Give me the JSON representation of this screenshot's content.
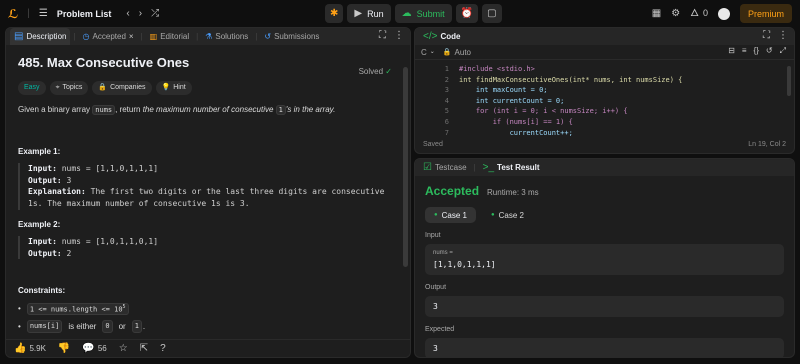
{
  "topbar": {
    "problem_list": "Problem List",
    "run": "Run",
    "submit": "Submit",
    "fire_count": "0",
    "premium": "Premium"
  },
  "left_tabs": [
    "Description",
    "Accepted",
    "Editorial",
    "Solutions",
    "Submissions"
  ],
  "problem": {
    "title": "485. Max Consecutive Ones",
    "solved": "Solved",
    "difficulty": "Easy",
    "chips": [
      "Topics",
      "Companies",
      "Hint"
    ],
    "statement_pre": "Given a binary array",
    "statement_code": "nums",
    "statement_mid": ", return",
    "statement_em": "the maximum number of consecutive",
    "statement_code2": "1",
    "statement_post": "'s in the array.",
    "example1_title": "Example 1:",
    "example1": {
      "input_label": "Input:",
      "input": "nums = [1,1,0,1,1,1]",
      "output_label": "Output:",
      "output": "3",
      "expl_label": "Explanation:",
      "explanation": "The first two digits or the last three digits are consecutive 1s. The maximum number of consecutive 1s is 3."
    },
    "example2_title": "Example 2:",
    "example2": {
      "input_label": "Input:",
      "input": "nums = [1,0,1,1,0,1]",
      "output_label": "Output:",
      "output": "2"
    },
    "constraints_title": "Constraints:",
    "constraint1": "1 <= nums.length <= 10",
    "constraint1_exp": "5",
    "constraint2_code": "nums[i]",
    "constraint2_mid": "is either",
    "constraint2_a": "0",
    "constraint2_or": "or",
    "constraint2_b": "1",
    "constraint2_end": "."
  },
  "footer": {
    "likes": "5.9K",
    "comments": "56"
  },
  "code": {
    "title": "Code",
    "language": "C",
    "auto": "Auto",
    "lines": [
      "#include <stdio.h>",
      "int findMaxConsecutiveOnes(int* nums, int numsSize) {",
      "    int maxCount = 0;",
      "    int currentCount = 0;",
      "    for (int i = 0; i < numsSize; i++) {",
      "        if (nums[i] == 1) {",
      "            currentCount++;"
    ],
    "saved": "Saved",
    "position": "Ln 19, Col 2"
  },
  "result": {
    "tab_testcase": "Testcase",
    "tab_result": "Test Result",
    "status": "Accepted",
    "runtime": "Runtime: 3 ms",
    "cases": [
      "Case 1",
      "Case 2"
    ],
    "input_label": "Input",
    "var_name": "nums =",
    "var_value": "[1,1,0,1,1,1]",
    "output_label": "Output",
    "output": "3",
    "expected_label": "Expected",
    "expected": "3"
  }
}
